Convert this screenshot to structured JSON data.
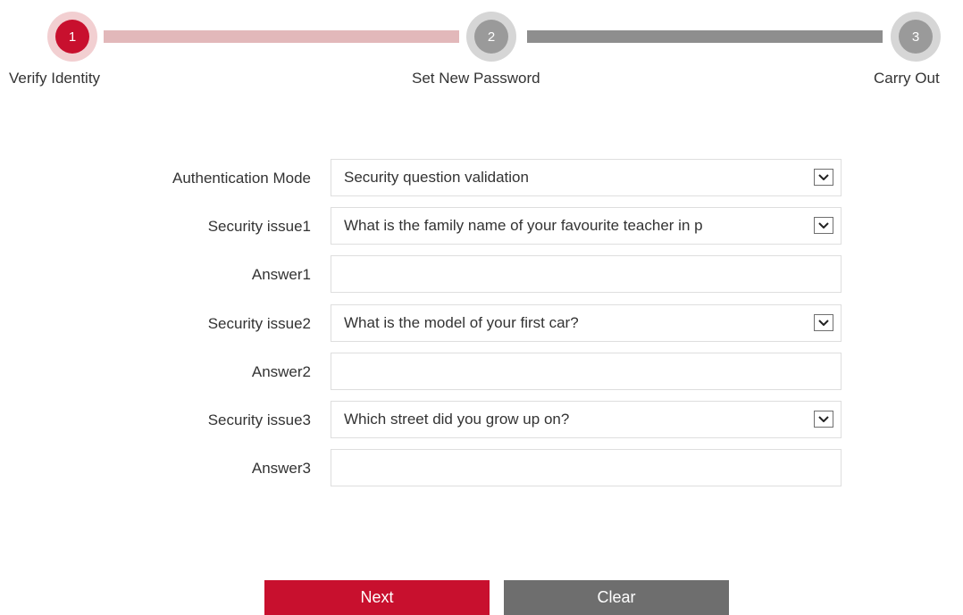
{
  "stepper": {
    "steps": [
      {
        "number": "1",
        "label": "Verify Identity",
        "state": "active"
      },
      {
        "number": "2",
        "label": "Set New Password",
        "state": "pending"
      },
      {
        "number": "3",
        "label": "Carry Out",
        "state": "pending"
      }
    ],
    "colors": {
      "active": "#c8102e",
      "active_ring": "#f2cfd1",
      "active_line": "#e2b8ba",
      "pending": "#9a9a9a",
      "pending_line": "#8e8e8e"
    }
  },
  "form": {
    "authentication_mode": {
      "label": "Authentication Mode",
      "value": "Security question validation"
    },
    "security_issue1": {
      "label": "Security issue1",
      "value": "What is the family name of your favourite teacher in p"
    },
    "answer1": {
      "label": "Answer1",
      "value": ""
    },
    "security_issue2": {
      "label": "Security issue2",
      "value": "What is the model of your first car?"
    },
    "answer2": {
      "label": "Answer2",
      "value": ""
    },
    "security_issue3": {
      "label": "Security issue3",
      "value": "Which street did you grow up on?"
    },
    "answer3": {
      "label": "Answer3",
      "value": ""
    }
  },
  "actions": {
    "next_label": "Next",
    "clear_label": "Clear",
    "primary_color": "#c8102e",
    "secondary_color": "#6e6e6e"
  },
  "icons": {
    "dropdown": "chevron-down-icon"
  }
}
